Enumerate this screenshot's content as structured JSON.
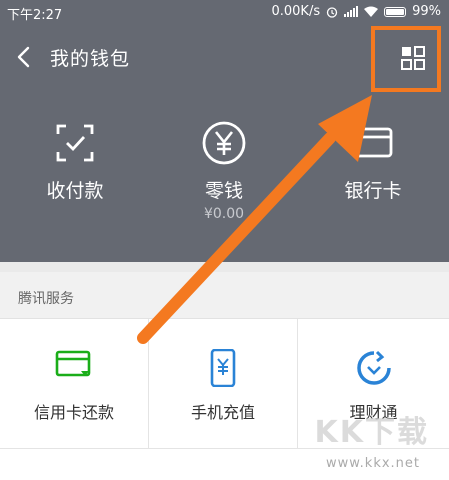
{
  "status_bar": {
    "time": "下午2:27",
    "network_speed": "0.00K/s",
    "battery": "99%"
  },
  "header": {
    "title": "我的钱包"
  },
  "wallet": {
    "items": [
      {
        "label": "收付款",
        "icon": "scan-pay-icon"
      },
      {
        "label": "零钱",
        "sub": "¥0.00",
        "icon": "yuan-circle-icon"
      },
      {
        "label": "银行卡",
        "icon": "bank-card-icon"
      }
    ]
  },
  "services": {
    "title": "腾讯服务",
    "items": [
      {
        "label": "信用卡还款",
        "icon": "credit-card-icon"
      },
      {
        "label": "手机充值",
        "icon": "phone-recharge-icon"
      },
      {
        "label": "理财通",
        "icon": "wealth-icon"
      }
    ]
  },
  "colors": {
    "header_bg": "#656972",
    "annotation": "#f47920",
    "accent_green": "#1aad19",
    "accent_blue": "#2a83d6"
  },
  "watermark": {
    "brand": "KK下载",
    "url": "www.kkx.net"
  }
}
